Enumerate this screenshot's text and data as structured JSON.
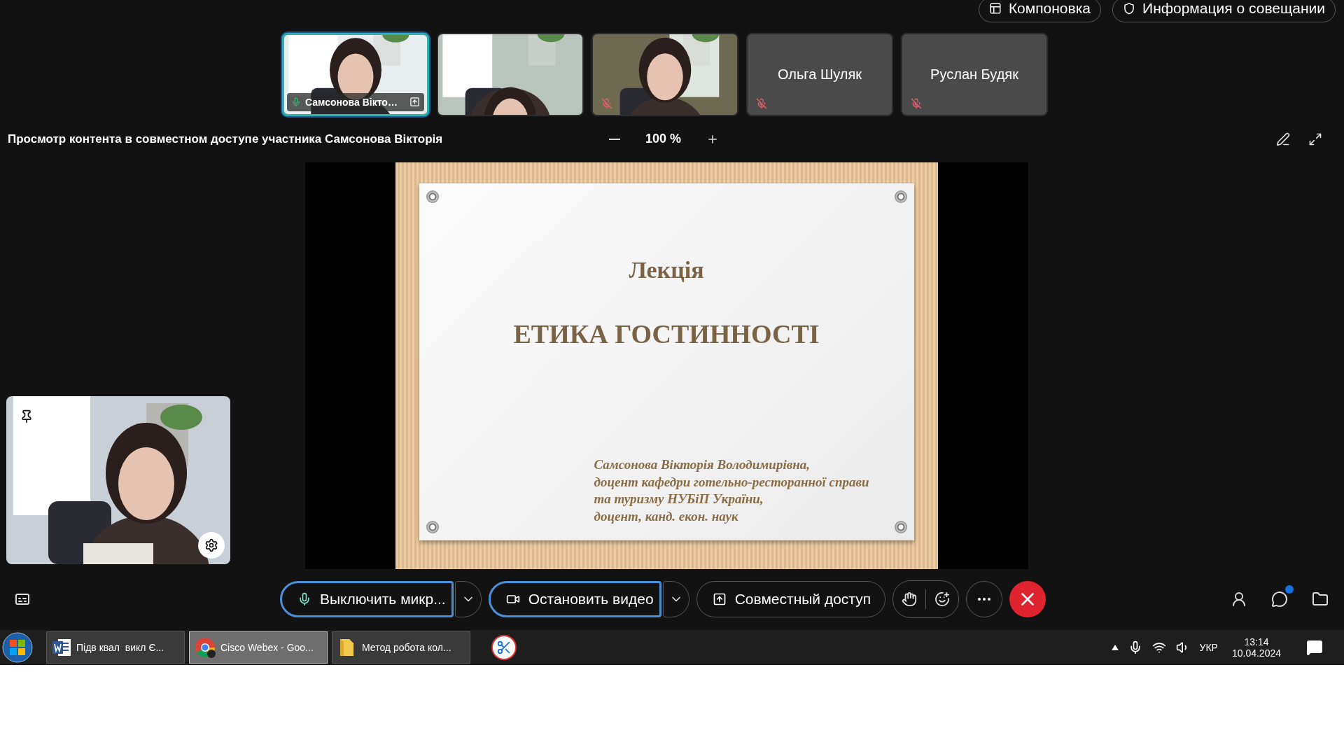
{
  "top_bar": {
    "buttons": [
      {
        "label": "Компоновка"
      },
      {
        "label": "Информация о совещании"
      }
    ]
  },
  "thumbnails": [
    {
      "kind": "video",
      "name": "Самсонова Вікто…",
      "selected": true,
      "muted": false,
      "sharing": true
    },
    {
      "kind": "video",
      "selected": false
    },
    {
      "kind": "video",
      "selected": false,
      "muted": true
    },
    {
      "kind": "name",
      "name": "Ольга Шуляк",
      "selected": false,
      "muted": true
    },
    {
      "kind": "name",
      "name": "Руслан Будяк",
      "selected": false,
      "muted": true
    }
  ],
  "content_header": {
    "title": "Просмотр контента в совместном доступе участника Самсонова Вікторія",
    "zoom": "100 %"
  },
  "slide": {
    "subtitle": "Лекція",
    "title": "ЕТИКА ГОСТИННОСТІ",
    "author_lines": [
      "Самсонова Вікторія Володимирівна,",
      "доцент кафедри готельно-ресторанної справи",
      "та туризму НУБіП України,",
      "доцент, канд. екон. наук"
    ]
  },
  "controls": [
    {
      "kind": "mic",
      "label": "Выключить микр...",
      "highlighted": true
    },
    {
      "kind": "video",
      "label": "Остановить видео",
      "highlighted": true
    },
    {
      "kind": "share",
      "label": "Совместный доступ",
      "highlighted": false
    }
  ],
  "side_controls": {
    "chat_unread": true
  },
  "taskbar": {
    "items": [
      {
        "kind": "document",
        "label": "Підв квал  викл Є...",
        "active": false
      },
      {
        "kind": "browser",
        "label": "Cisco Webex - Goo...",
        "active": true
      },
      {
        "kind": "folder",
        "label": "Метод робота кол...",
        "active": false
      }
    ],
    "language": "УКР",
    "time": "13:14",
    "date": "10.04.2024"
  }
}
